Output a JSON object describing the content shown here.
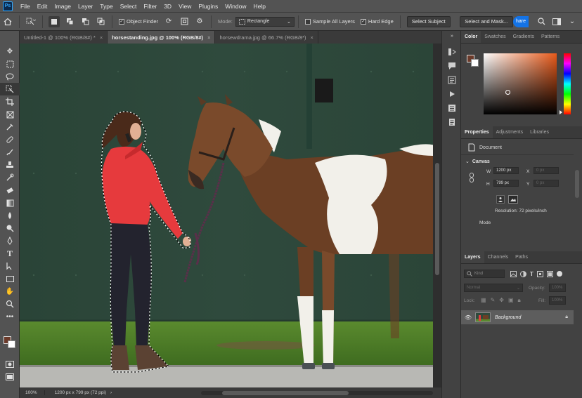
{
  "app": {
    "logo_text": "Ps"
  },
  "menubar": {
    "items": [
      "File",
      "Edit",
      "Image",
      "Layer",
      "Type",
      "Select",
      "Filter",
      "3D",
      "View",
      "Plugins",
      "Window",
      "Help"
    ]
  },
  "options": {
    "object_finder_label": "Object Finder",
    "mode_label": "Mode:",
    "mode_value": "Rectangle",
    "sample_all_layers_label": "Sample All Layers",
    "hard_edge_label": "Hard Edge",
    "select_subject_label": "Select Subject",
    "select_mask_label": "Select and Mask...",
    "share_label": "hare"
  },
  "tabs": [
    {
      "label": "Untitled-1 @ 100% (RGB/8#) *",
      "close": "×"
    },
    {
      "label": "horsestanding.jpg @ 100% (RGB/8#)",
      "close": "×"
    },
    {
      "label": "horsewdrama.jpg @ 66.7% (RGB/8*)",
      "close": "×"
    }
  ],
  "status": {
    "zoom": "100%",
    "doc_info": "1200 px x 799 px (72 ppi)"
  },
  "color_panel": {
    "tabs": [
      "Color",
      "Swatches",
      "Gradients",
      "Patterns"
    ]
  },
  "properties_panel": {
    "tabs": [
      "Properties",
      "Adjustments",
      "Libraries"
    ],
    "document_label": "Document",
    "canvas_label": "Canvas",
    "w_label": "W",
    "w_value": "1200 px",
    "h_label": "H",
    "h_value": "799 px",
    "x_label": "X",
    "x_value": "0 px",
    "y_label": "Y",
    "y_value": "0 px",
    "resolution": "Resolution: 72 pixels/inch",
    "mode_label": "Mode"
  },
  "layers_panel": {
    "tabs": [
      "Layers",
      "Channels",
      "Paths"
    ],
    "kind_placeholder": "Kind",
    "blend_mode": "Normal",
    "opacity_label": "Opacity:",
    "opacity_value": "100%",
    "lock_label": "Lock:",
    "fill_label": "Fill:",
    "fill_value": "100%",
    "layer_name": "Background"
  },
  "colors": {
    "foreground": "#6b3a2a",
    "background": "#ffffff",
    "accent": "#1473e6"
  }
}
